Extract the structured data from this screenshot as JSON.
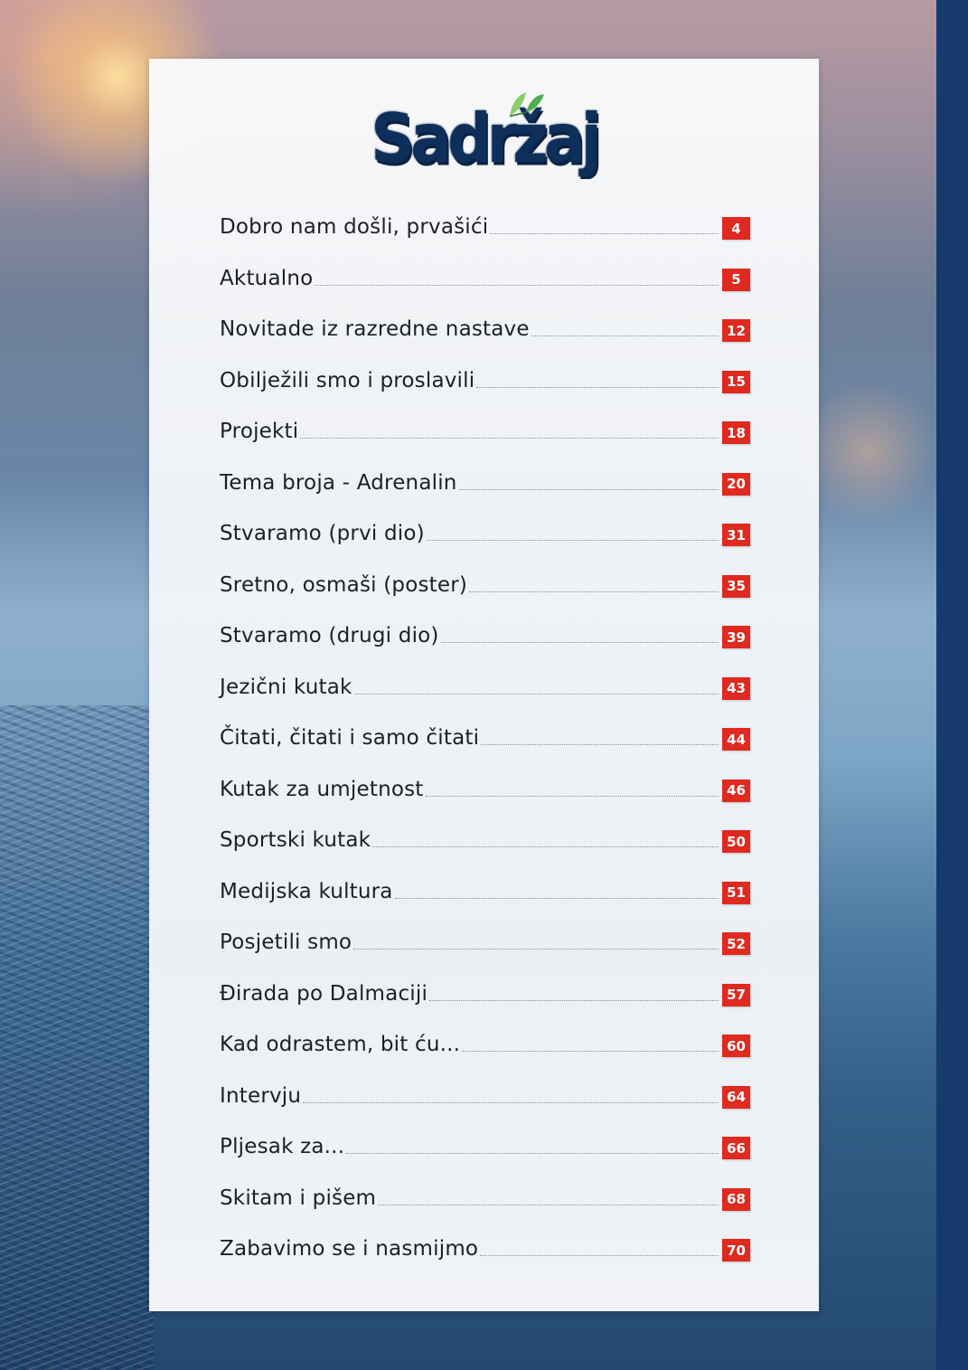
{
  "page": {
    "title": "Sadržaj",
    "colors": {
      "title": "#0f2f5b",
      "badge": "#e0291f",
      "leaf": "#5cb85c",
      "side_bar": "#173a6c"
    }
  },
  "toc": [
    {
      "label": "Dobro nam došli, prvašići",
      "page": "4"
    },
    {
      "label": "Aktualno",
      "page": "5"
    },
    {
      "label": "Novitade iz razredne nastave",
      "page": "12"
    },
    {
      "label": "Obilježili smo i proslavili",
      "page": "15"
    },
    {
      "label": "Projekti",
      "page": "18"
    },
    {
      "label": "Tema broja - Adrenalin",
      "page": "20"
    },
    {
      "label": "Stvaramo (prvi dio)",
      "page": "31"
    },
    {
      "label": "Sretno, osmaši (poster)",
      "page": "35"
    },
    {
      "label": "Stvaramo (drugi dio)",
      "page": "39"
    },
    {
      "label": "Jezični kutak",
      "page": "43"
    },
    {
      "label": "Čitati, čitati i samo čitati",
      "page": "44"
    },
    {
      "label": "Kutak za umjetnost",
      "page": "46"
    },
    {
      "label": "Sportski kutak",
      "page": "50"
    },
    {
      "label": "Medijska kultura",
      "page": "51"
    },
    {
      "label": "Posjetili smo",
      "page": "52"
    },
    {
      "label": "Đirada po Dalmaciji",
      "page": "57"
    },
    {
      "label": "Kad odrastem, bit ću...",
      "page": "60"
    },
    {
      "label": "Intervju",
      "page": "64"
    },
    {
      "label": "Pljesak za...",
      "page": "66"
    },
    {
      "label": "Skitam i pišem",
      "page": "68"
    },
    {
      "label": "Zabavimo se i nasmijmo",
      "page": "70"
    }
  ]
}
